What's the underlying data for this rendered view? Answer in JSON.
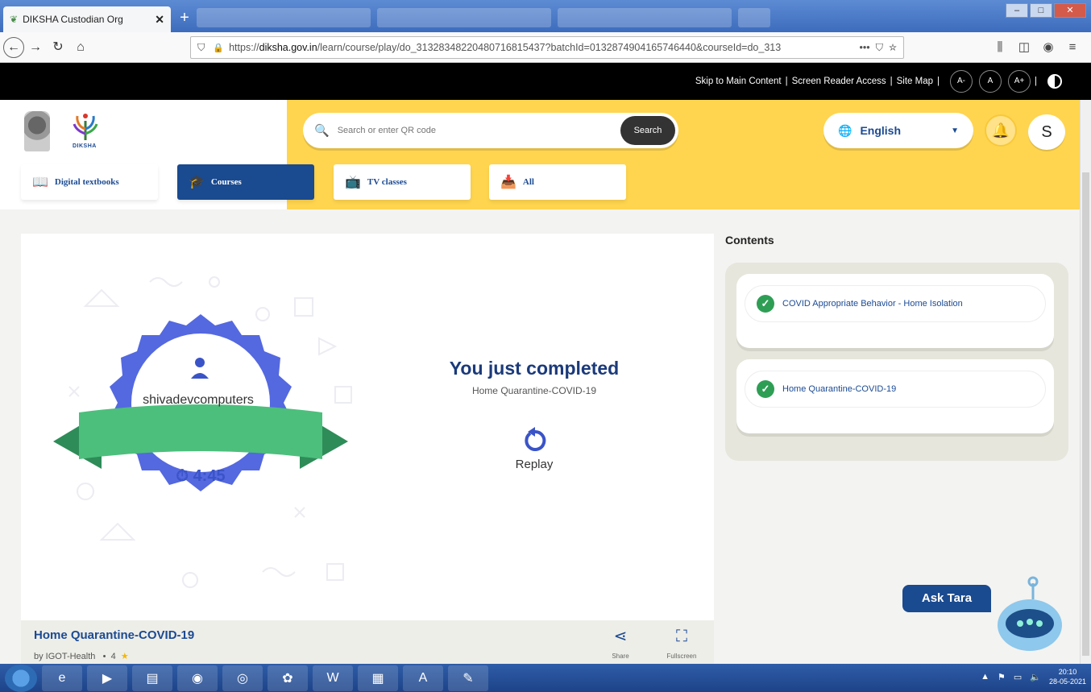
{
  "browser": {
    "active_tab_title": "DIKSHA Custodian Org",
    "url_prefix": "https://",
    "url_domain": "diksha.gov.in",
    "url_path": "/learn/course/play/do_31328348220480716815437?batchId=0132874904165746440&courseId=do_313",
    "url_more": "•••"
  },
  "accessibility": {
    "skip": "Skip to Main Content",
    "screen_reader": "Screen Reader Access",
    "sitemap": "Site Map",
    "font_minus": "A-",
    "font_normal": "A",
    "font_plus": "A+"
  },
  "header": {
    "logo_text": "DIKSHA",
    "search_placeholder": "Search or enter QR code",
    "search_button": "Search",
    "language": "English",
    "avatar_letter": "S"
  },
  "nav": {
    "digital_textbooks": "Digital textbooks",
    "courses": "Courses",
    "tv_classes": "TV classes",
    "all": "All"
  },
  "player": {
    "badge_user": "shivadevcomputers",
    "badge_time": "4:45",
    "completed_title": "You just completed",
    "completed_course": "Home Quarantine-COVID-19",
    "replay": "Replay",
    "course_title": "Home Quarantine-COVID-19",
    "course_by": "by IGOT-Health",
    "rating": "4",
    "share": "Share",
    "fullscreen": "Fullscreen"
  },
  "contents": {
    "heading": "Contents",
    "items": [
      {
        "title": "COVID Appropriate Behavior - Home Isolation"
      },
      {
        "title": "Home Quarantine-COVID-19"
      }
    ]
  },
  "assistant": {
    "label": "Ask Tara"
  },
  "taskbar": {
    "time": "20:10",
    "date": "28-05-2021"
  },
  "colors": {
    "brand_blue": "#1a4a8f",
    "header_yellow": "#ffd54f",
    "badge_blue": "#5468e0",
    "ribbon_green": "#4cbf7c",
    "check_green": "#2f9e55"
  }
}
